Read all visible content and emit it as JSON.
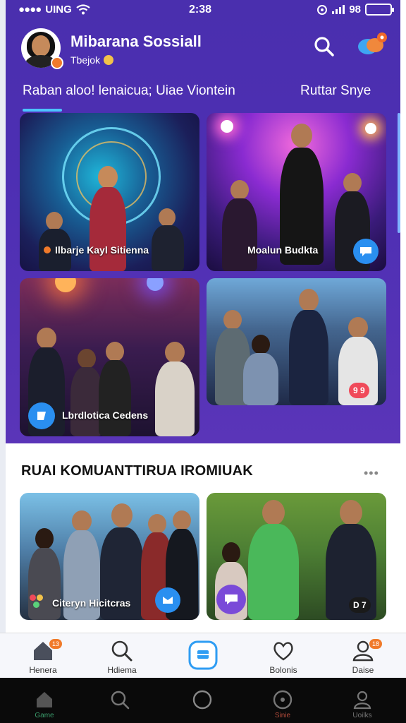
{
  "status_bar": {
    "carrier": "UING",
    "time": "2:38",
    "battery_text": "98"
  },
  "header": {
    "app_title": "Mibarana Sossiall",
    "subtitle": "Tbejok"
  },
  "tabs": [
    {
      "label": "Raban aloo! lenaicua; Uiae Viontein",
      "active": true
    },
    {
      "label": "Ruttar Snye",
      "active": false
    }
  ],
  "featured_cards": [
    {
      "label": "Ilbarje Kayl Sitienna"
    },
    {
      "label": "Moalun Budkta"
    },
    {
      "label": "Lbrdlotica Cedens"
    },
    {
      "label": "",
      "badge": "9 9"
    }
  ],
  "section": {
    "title": "RUAI KOMUANTTIRUA IROMIUAK",
    "more": "•••"
  },
  "community_cards": [
    {
      "label": "Citeryn Hicitcras"
    },
    {
      "label": "",
      "badge": "D 7"
    }
  ],
  "bottom_nav": [
    {
      "label": "Henera",
      "icon": "home-icon",
      "badge": "13"
    },
    {
      "label": "Hdiema",
      "icon": "search-icon",
      "badge": ""
    },
    {
      "label": "",
      "icon": "create-icon",
      "badge": ""
    },
    {
      "label": "Bolonis",
      "icon": "heart-icon",
      "badge": ""
    },
    {
      "label": "Daise",
      "icon": "profile-icon",
      "badge": "18"
    }
  ],
  "system_bar": [
    {
      "label": "Game",
      "icon": "home-icon"
    },
    {
      "label": "",
      "icon": "search-icon"
    },
    {
      "label": "",
      "icon": "circle-icon"
    },
    {
      "label": "Sinie",
      "icon": "compass-icon"
    },
    {
      "label": "Uoilks",
      "icon": "profile-icon"
    }
  ],
  "colors": {
    "hero_bg": "#4a2fae",
    "accent": "#4cc3ff",
    "badge": "#f07a2a"
  }
}
